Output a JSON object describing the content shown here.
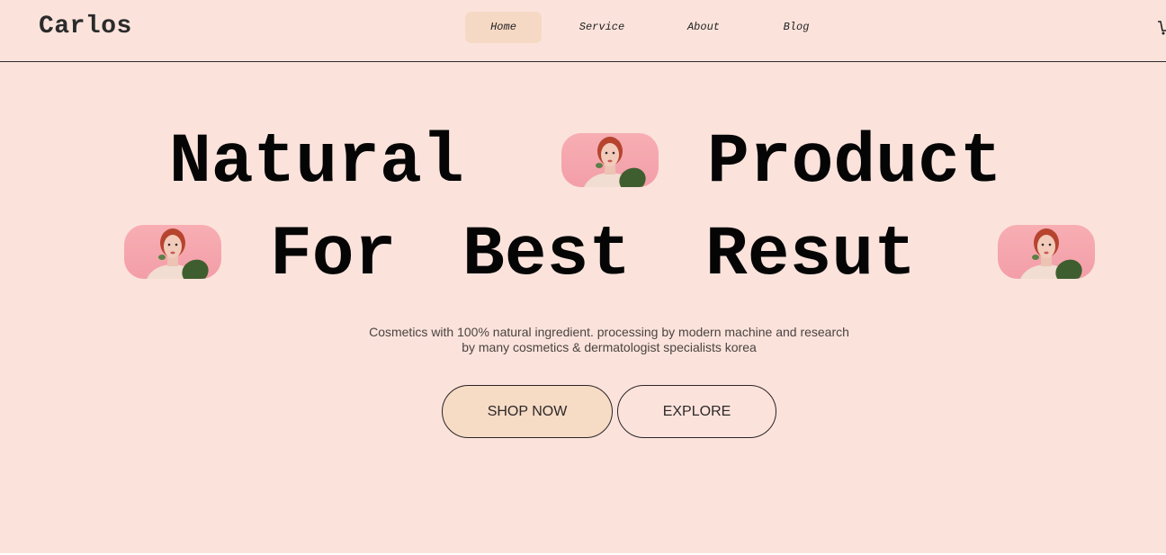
{
  "brand": {
    "logo_text": "Carlos"
  },
  "nav": {
    "items": [
      {
        "label": "Home",
        "active": true
      },
      {
        "label": "Service",
        "active": false
      },
      {
        "label": "About",
        "active": false
      },
      {
        "label": "Blog",
        "active": false
      }
    ],
    "cart_icon": "cart-icon"
  },
  "hero": {
    "headline": {
      "word1": "Natural",
      "word2": "Product",
      "word3": "For",
      "word4": "Best",
      "word5": "Resut"
    },
    "description": {
      "line1": "Cosmetics with 100% natural ingredient. processing by modern machine and research",
      "line2": "by many cosmetics & dermatologist specialists korea"
    },
    "buttons": {
      "shop_now": "SHOP NOW",
      "explore": "EXPLORE"
    }
  },
  "colors": {
    "background": "#fbe3dc",
    "accent": "#f6dbc5",
    "pill_bg": "#f7aeb3",
    "text": "#050505"
  }
}
